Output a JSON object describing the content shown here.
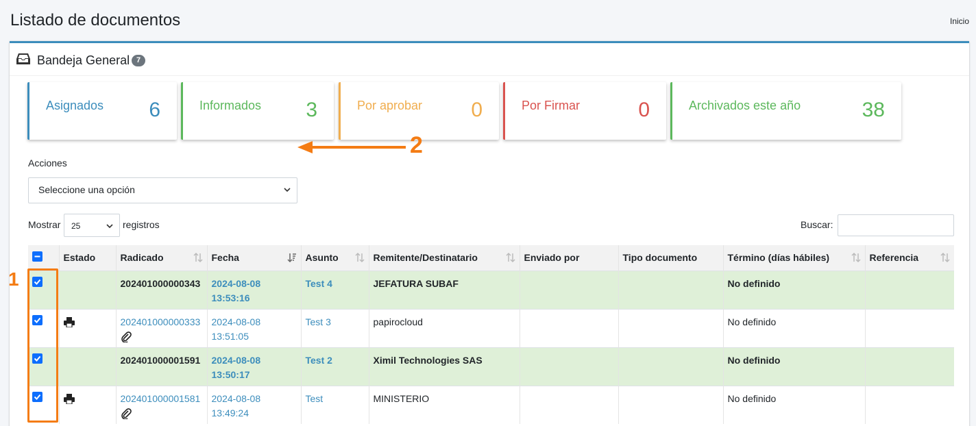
{
  "page": {
    "title": "Listado de documentos",
    "breadcrumb": "Inicio"
  },
  "card": {
    "title": "Bandeja General",
    "badge": "7",
    "icon": "inbox-icon"
  },
  "stats": [
    {
      "label": "Asignados",
      "value": "6",
      "color": "#3c8dbc"
    },
    {
      "label": "Informados",
      "value": "3",
      "color": "#5cb85c"
    },
    {
      "label": "Por aprobar",
      "value": "0",
      "color": "#f0ad4e"
    },
    {
      "label": "Por Firmar",
      "value": "0",
      "color": "#d9534f"
    },
    {
      "label": "Archivados este año",
      "value": "38",
      "color": "#5cb85c"
    }
  ],
  "actions": {
    "label": "Acciones",
    "selected": "Seleccione una opción"
  },
  "length": {
    "prefix": "Mostrar",
    "selected": "25",
    "suffix": "registros"
  },
  "search": {
    "label": "Buscar:",
    "value": ""
  },
  "table": {
    "headers": [
      "Estado",
      "Radicado",
      "Fecha",
      "Asunto",
      "Remitente/Destinatario",
      "Enviado por",
      "Tipo documento",
      "Término (días hábiles)",
      "Referencia"
    ],
    "rows": [
      {
        "radicado": "202401000000343",
        "fecha": "2024-08-08",
        "hora": "13:53:16",
        "asunto": "Test 4",
        "remitente": "JEFATURA SUBAF",
        "enviado": "",
        "tipo": "",
        "termino": "No definido",
        "referencia": ""
      },
      {
        "radicado": "202401000000333",
        "fecha": "2024-08-08",
        "hora": "13:51:05",
        "asunto": "Test 3",
        "remitente": "papirocloud",
        "enviado": "",
        "tipo": "",
        "termino": "No definido",
        "referencia": ""
      },
      {
        "radicado": "202401000001591",
        "fecha": "2024-08-08",
        "hora": "13:50:17",
        "asunto": "Test 2",
        "remitente": "Ximil Technologies SAS",
        "enviado": "",
        "tipo": "",
        "termino": "No definido",
        "referencia": ""
      },
      {
        "radicado": "202401000001581",
        "fecha": "2024-08-08",
        "hora": "13:49:24",
        "asunto": "Test",
        "remitente": "MINISTERIO",
        "enviado": "",
        "tipo": "",
        "termino": "No definido",
        "referencia": ""
      }
    ]
  },
  "annotations": {
    "one": "1",
    "two": "2",
    "color": "#f47c14"
  }
}
